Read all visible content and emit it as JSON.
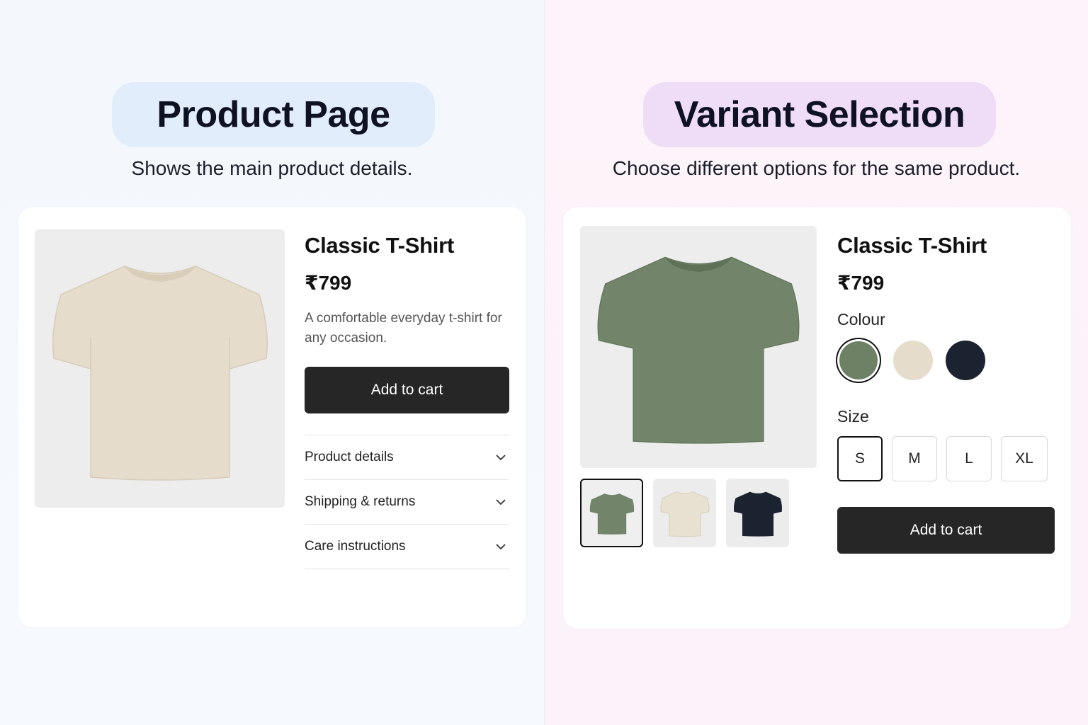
{
  "left": {
    "heading": "Product Page",
    "subtitle": "Shows the main product details.",
    "product": {
      "title": "Classic T-Shirt",
      "price": "₹799",
      "description": "A comfortable  everyday t-shirt for any occasion.",
      "image_color": "#e5dccb",
      "add_to_cart": "Add to cart",
      "accordion": [
        {
          "label": "Product details"
        },
        {
          "label": "Shipping & returns"
        },
        {
          "label": "Care instructions"
        }
      ]
    }
  },
  "right": {
    "heading": "Variant Selection",
    "subtitle": "Choose different options for the same product.",
    "product": {
      "title": "Classic T-Shirt",
      "price": "₹799",
      "image_color": "#72856a",
      "colour_label": "Colour",
      "colours": [
        {
          "name": "green",
          "hex": "#6f8165",
          "selected": true
        },
        {
          "name": "beige",
          "hex": "#e5dccb",
          "selected": false
        },
        {
          "name": "navy",
          "hex": "#1c2330",
          "selected": false
        }
      ],
      "size_label": "Size",
      "sizes": [
        {
          "label": "S",
          "selected": true
        },
        {
          "label": "M",
          "selected": false
        },
        {
          "label": "L",
          "selected": false
        },
        {
          "label": "XL",
          "selected": false
        }
      ],
      "thumbnails": [
        {
          "color": "#72856a",
          "selected": true
        },
        {
          "color": "#e8e0d0",
          "selected": false
        },
        {
          "color": "#1c2330",
          "selected": false
        }
      ],
      "add_to_cart": "Add to cart"
    }
  },
  "colors": {
    "left_pill": "#e2edfb",
    "right_pill": "#efdcf7",
    "button_dark": "#262626"
  }
}
